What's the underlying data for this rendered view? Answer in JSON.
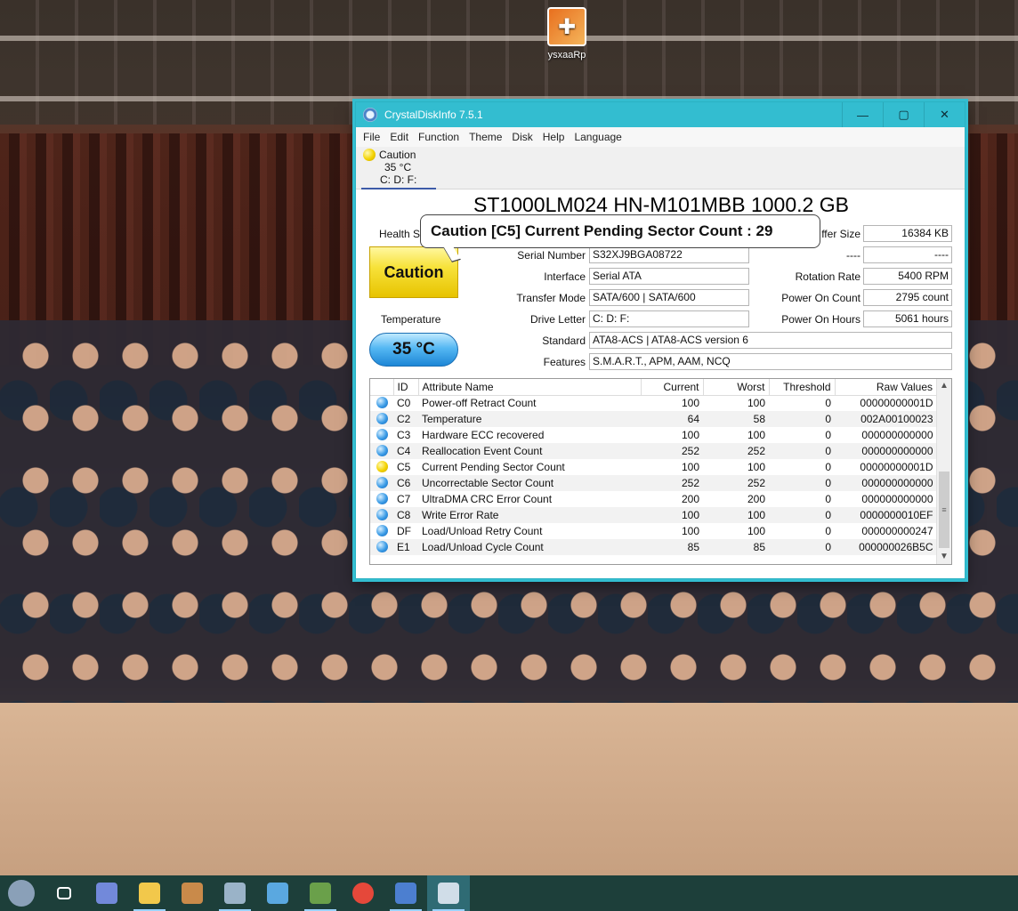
{
  "desktop": {
    "icon_label": "ysxaaRp"
  },
  "window": {
    "title": "CrystalDiskInfo 7.5.1",
    "controls": {
      "minimize": "—",
      "maximize": "▢",
      "close": "✕"
    }
  },
  "menu": [
    "File",
    "Edit",
    "Function",
    "Theme",
    "Disk",
    "Help",
    "Language"
  ],
  "disk_tab": {
    "status": "Caution",
    "temperature": "35 °C",
    "drives": "C: D: F:"
  },
  "drive": {
    "model": "ST1000LM024 HN-M101MBB 1000.2 GB",
    "health_label": "Health S",
    "health_status": "Caution",
    "temperature_label": "Temperature",
    "temperature": "35 °C",
    "tooltip": "Caution [C5] Current Pending Sector Count : 29",
    "fields": {
      "serial_label": "Serial Number",
      "serial": "S32XJ9BGA08722",
      "interface_label": "Interface",
      "interface": "Serial ATA",
      "transfer_label": "Transfer Mode",
      "transfer": "SATA/600 | SATA/600",
      "letter_label": "Drive Letter",
      "letter": "C: D: F:",
      "standard_label": "Standard",
      "standard": "ATA8-ACS | ATA8-ACS version 6",
      "features_label": "Features",
      "features": "S.M.A.R.T., APM, AAM, NCQ",
      "buffer_label": "ffer Size",
      "buffer": "16384 KB",
      "blank_label": "----",
      "blank": "----",
      "rotation_label": "Rotation Rate",
      "rotation": "5400 RPM",
      "power_count_label": "Power On Count",
      "power_count": "2795 count",
      "power_hours_label": "Power On Hours",
      "power_hours": "5061 hours"
    }
  },
  "smart": {
    "columns": [
      "ID",
      "Attribute Name",
      "Current",
      "Worst",
      "Threshold",
      "Raw Values"
    ],
    "rows": [
      {
        "status": "good",
        "id": "C0",
        "name": "Power-off Retract Count",
        "current": "100",
        "worst": "100",
        "threshold": "0",
        "raw": "00000000001D"
      },
      {
        "status": "good",
        "id": "C2",
        "name": "Temperature",
        "current": "64",
        "worst": "58",
        "threshold": "0",
        "raw": "002A00100023"
      },
      {
        "status": "good",
        "id": "C3",
        "name": "Hardware ECC recovered",
        "current": "100",
        "worst": "100",
        "threshold": "0",
        "raw": "000000000000"
      },
      {
        "status": "good",
        "id": "C4",
        "name": "Reallocation Event Count",
        "current": "252",
        "worst": "252",
        "threshold": "0",
        "raw": "000000000000"
      },
      {
        "status": "caution",
        "id": "C5",
        "name": "Current Pending Sector Count",
        "current": "100",
        "worst": "100",
        "threshold": "0",
        "raw": "00000000001D"
      },
      {
        "status": "good",
        "id": "C6",
        "name": "Uncorrectable Sector Count",
        "current": "252",
        "worst": "252",
        "threshold": "0",
        "raw": "000000000000"
      },
      {
        "status": "good",
        "id": "C7",
        "name": "UltraDMA CRC Error Count",
        "current": "200",
        "worst": "200",
        "threshold": "0",
        "raw": "000000000000"
      },
      {
        "status": "good",
        "id": "C8",
        "name": "Write Error Rate",
        "current": "100",
        "worst": "100",
        "threshold": "0",
        "raw": "0000000010EF"
      },
      {
        "status": "good",
        "id": "DF",
        "name": "Load/Unload Retry Count",
        "current": "100",
        "worst": "100",
        "threshold": "0",
        "raw": "000000000247"
      },
      {
        "status": "good",
        "id": "E1",
        "name": "Load/Unload Cycle Count",
        "current": "85",
        "worst": "85",
        "threshold": "0",
        "raw": "000000026B5C"
      }
    ]
  },
  "taskbar": {
    "items": [
      {
        "name": "start-button",
        "color": "#8aa0b8"
      },
      {
        "name": "task-view-button",
        "color": "#ffffff"
      },
      {
        "name": "discord-app",
        "color": "#7289da"
      },
      {
        "name": "file-explorer-app",
        "color": "#f2c84b"
      },
      {
        "name": "app-5",
        "color": "#c98a4a"
      },
      {
        "name": "app-6",
        "color": "#9ab3c8"
      },
      {
        "name": "app-7",
        "color": "#5aa8e0"
      },
      {
        "name": "app-8",
        "color": "#6aa04a"
      },
      {
        "name": "chrome-app",
        "color": "#e5483a"
      },
      {
        "name": "app-10",
        "color": "#4c7fd0"
      },
      {
        "name": "crystaldiskinfo-app",
        "color": "#d0dde8"
      }
    ]
  }
}
